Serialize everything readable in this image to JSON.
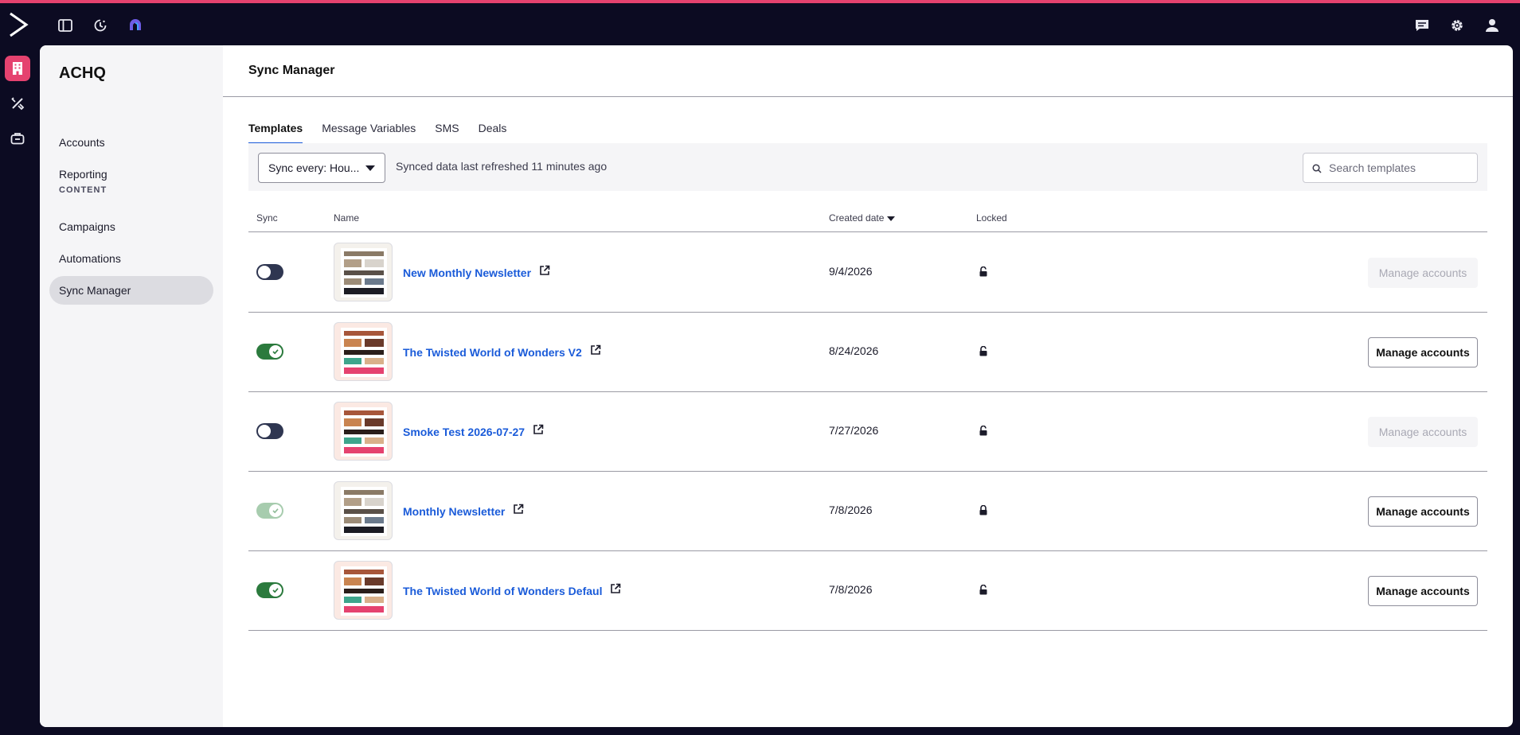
{
  "topbar": {
    "icons": [
      "logo-chevron-icon",
      "panel-toggle-icon",
      "recent-clock-icon",
      "brand-app-icon"
    ],
    "right_icons": [
      "chat-icon",
      "gear-icon",
      "user-icon"
    ],
    "accent_color": "#e5426f"
  },
  "rail": {
    "items": [
      "building-icon",
      "tools-icon",
      "briefcase-icon"
    ]
  },
  "sidebar": {
    "org": "ACHQ",
    "links": [
      {
        "label": "Accounts"
      },
      {
        "label": "Reporting"
      }
    ],
    "section_label": "CONTENT",
    "content_links": [
      {
        "label": "Campaigns"
      },
      {
        "label": "Automations"
      },
      {
        "label": "Sync Manager",
        "active": true
      }
    ]
  },
  "main": {
    "title": "Sync Manager",
    "tabs": [
      {
        "label": "Templates",
        "active": true
      },
      {
        "label": "Message Variables"
      },
      {
        "label": "SMS"
      },
      {
        "label": "Deals"
      }
    ],
    "toolbar": {
      "sync_select": "Sync every: Hou...",
      "refresh_text": "Synced data last refreshed 11 minutes ago",
      "search_placeholder": "Search templates"
    },
    "columns": {
      "sync": "Sync",
      "name": "Name",
      "created": "Created date",
      "locked": "Locked"
    },
    "rows": [
      {
        "name": "New Monthly Newsletter",
        "date": "9/4/2026",
        "sync": "off",
        "manage": "Manage accounts",
        "manage_enabled": false
      },
      {
        "name": "The Twisted World of Wonders V2",
        "date": "8/24/2026",
        "sync": "on",
        "manage": "Manage accounts",
        "manage_enabled": true
      },
      {
        "name": "Smoke Test 2026-07-27",
        "date": "7/27/2026",
        "sync": "off",
        "manage": "Manage accounts",
        "manage_enabled": false
      },
      {
        "name": "Monthly Newsletter",
        "date": "7/8/2026",
        "sync": "on-disabled",
        "manage": "Manage accounts",
        "manage_enabled": true
      },
      {
        "name": "The Twisted World of Wonders Defaul",
        "date": "7/8/2026",
        "sync": "on",
        "manage": "Manage accounts",
        "manage_enabled": true
      }
    ]
  }
}
